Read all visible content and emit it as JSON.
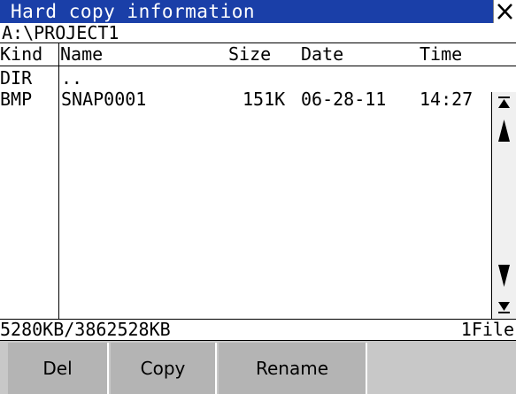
{
  "window": {
    "title": "Hard copy information",
    "close_icon": "close-icon"
  },
  "path": "A:\\PROJECT1",
  "columns": {
    "kind": "Kind",
    "name": "Name",
    "size": "Size",
    "date": "Date",
    "time": "Time"
  },
  "files": [
    {
      "kind": "DIR",
      "name": "..",
      "size": "",
      "date": "",
      "time": ""
    },
    {
      "kind": "BMP",
      "name": "SNAP0001",
      "size": "151K",
      "date": "06-28-11",
      "time": "14:27"
    }
  ],
  "status": {
    "capacity": "5280KB/3862528KB",
    "count": "1File"
  },
  "buttons": {
    "delete": "Del",
    "copy": "Copy",
    "rename": "Rename"
  },
  "colors": {
    "titlebar": "#1a3fa8",
    "button": "#b4b4b4",
    "scrollbar": "#f0f0f0"
  }
}
